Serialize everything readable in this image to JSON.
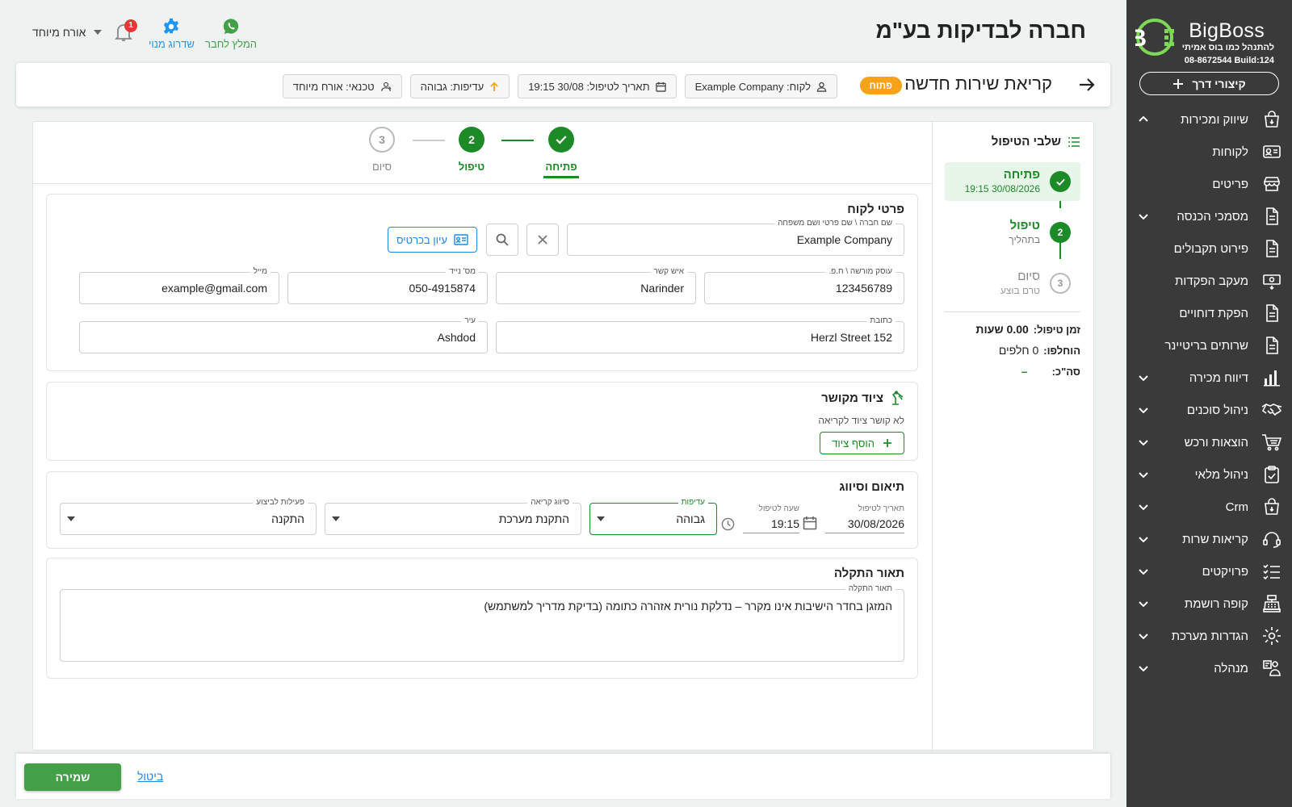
{
  "brand": {
    "name": "BigBoss",
    "tagline": "להתנהל כמו בוס אמיתי",
    "phone_build": "08-8672544 Build:124",
    "shortcut_label": "קיצורי דרך",
    "accent": "#1b8a27"
  },
  "sidebar": {
    "items": [
      {
        "label": "שיווק ומכירות",
        "icon": "shopping-bag-icon"
      },
      {
        "label": "לקוחות",
        "icon": "contact-card-icon"
      },
      {
        "label": "פריטים",
        "icon": "store-icon"
      },
      {
        "label": "מסמכי הכנסה",
        "icon": "document-icon"
      },
      {
        "label": "פירוט תקבולים",
        "icon": "document-icon"
      },
      {
        "label": "מעקב הפקדות",
        "icon": "cash-icon"
      },
      {
        "label": "הפקת דוחויים",
        "icon": "document-icon"
      },
      {
        "label": "שרותים בריטיינר",
        "icon": "document-icon"
      },
      {
        "label": "דיווח מכירה",
        "icon": "bar-chart-icon"
      },
      {
        "label": "ניהול סוכנים",
        "icon": "handshake-icon"
      },
      {
        "label": "הוצאות ורכש",
        "icon": "cart-icon"
      },
      {
        "label": "ניהול מלאי",
        "icon": "clipboard-check-icon"
      },
      {
        "label": "Crm",
        "icon": "shopping-bag-icon"
      },
      {
        "label": "קריאות שרות",
        "icon": "headset-icon"
      },
      {
        "label": "פרויקטים",
        "icon": "checklist-icon"
      },
      {
        "label": "קופה רושמת",
        "icon": "cash-register-icon"
      },
      {
        "label": "הגדרות מערכת",
        "icon": "gear-icon"
      },
      {
        "label": "מנהלה",
        "icon": "manager-icon"
      }
    ]
  },
  "header": {
    "company": "חברה לבדיקות בע\"מ",
    "user": "אורח מיוחד",
    "notif_count": "1",
    "upgrade_label": "שדרוג מנוי",
    "recommend_label": "המלץ לחבר"
  },
  "call": {
    "title": "קריאת שירות חדשה",
    "status": "פתוח",
    "chips": [
      {
        "label": "לקוח: Example Company",
        "icon": "person-icon"
      },
      {
        "label": "תאריך לטיפול: 30/08 19:15",
        "icon": "calendar-icon"
      },
      {
        "label": "עדיפות: גבוהה",
        "icon": "arrow-up-icon"
      },
      {
        "label": "טכנאי: אורח מיוחד",
        "icon": "technician-icon"
      }
    ]
  },
  "stages": {
    "title": "שלבי הטיפול",
    "items": [
      {
        "num": "",
        "name": "פתיחה",
        "sub": "30/08/2026 19:15"
      },
      {
        "num": "2",
        "name": "טיפול",
        "sub": "בתהליך"
      },
      {
        "num": "3",
        "name": "סיום",
        "sub": "טרם בוצע"
      }
    ],
    "time_label": "זמן טיפול:",
    "time_value": "0.00 שעות",
    "parts_label": "הוחלפו:",
    "parts_value": "0 חלפים",
    "total_label": "סה\"כ:",
    "total_value": "–"
  },
  "stepper": {
    "steps": [
      {
        "num": "",
        "label": "פתיחה"
      },
      {
        "num": "2",
        "label": "טיפול"
      },
      {
        "num": "3",
        "label": "סיום"
      }
    ]
  },
  "customer": {
    "title": "פרטי לקוח",
    "name_label": "שם חברה \\ שם פרטי ושם משפחה",
    "name_value": "Example Company",
    "card_button": "עיון בכרטיס",
    "fields": [
      {
        "label": "עוסק מורשה \\ ח.פ.",
        "value": "123456789"
      },
      {
        "label": "איש קשר",
        "value": "Narinder"
      },
      {
        "label": "מס' נייד",
        "value": "050-4915874"
      },
      {
        "label": "מייל",
        "value": "example@gmail.com"
      },
      {
        "label": "כתובת",
        "value": "Herzl Street 152"
      },
      {
        "label": "עיר",
        "value": "Ashdod"
      }
    ]
  },
  "equipment": {
    "title": "ציוד מקושר",
    "note": "לא קושר ציוד לקריאה",
    "add_button": "הוסף ציוד"
  },
  "scheduling": {
    "title": "תיאום וסיווג",
    "date_label": "תאריך לטיפול",
    "date_value": "30/08/2026",
    "time_label": "שעה לטיפול",
    "time_value": "19:15",
    "priority_label": "עדיפות",
    "priority_value": "גבוהה",
    "category_label": "סיווג קריאה",
    "category_value": "התקנת מערכת",
    "action_label": "פעילות לביצוע",
    "action_value": "התקנה"
  },
  "problem": {
    "title": "תאור התקלה",
    "label": "תאור התקלה",
    "value": "המזגן בחדר הישיבות אינו מקרר – נדלקת נורית אזהרה כתומה (בדיקת מדריך למשתמש)"
  },
  "footer": {
    "save": "שמירה",
    "cancel": "ביטול"
  }
}
